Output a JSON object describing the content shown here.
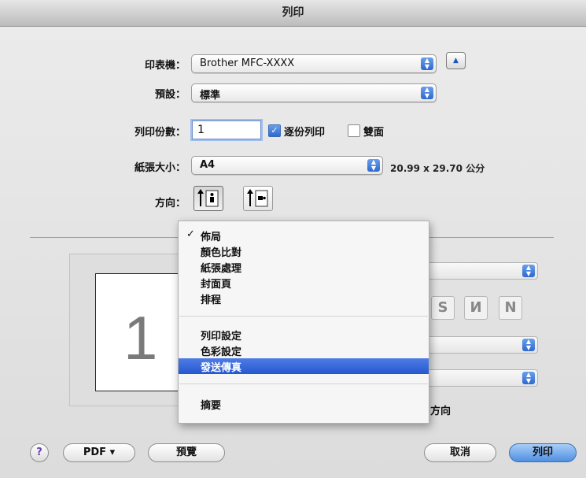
{
  "window": {
    "title": "列印"
  },
  "printer": {
    "label": "印表機：",
    "value": "Brother MFC-XXXX"
  },
  "presets": {
    "label": "預設：",
    "value": "標準"
  },
  "copies": {
    "label": "列印份數：",
    "value": "1",
    "collate_label": "逐份列印",
    "collate_checked": true,
    "duplex_label": "雙面",
    "duplex_checked": false
  },
  "paper_size": {
    "label": "紙張大小：",
    "value": "A4",
    "dimensions": "20.99 x 29.70 公分"
  },
  "orientation": {
    "label": "方向：",
    "selected": "portrait"
  },
  "preview": {
    "page_number": "1"
  },
  "panel_menu": {
    "items": [
      {
        "label": "佈局",
        "checked": true,
        "check": "✓"
      },
      {
        "label": "顏色比對"
      },
      {
        "label": "紙張處理"
      },
      {
        "label": "封面頁"
      },
      {
        "label": "排程"
      },
      {
        "label": "列印設定"
      },
      {
        "label": "色彩設定"
      },
      {
        "label": "發送傳真",
        "highlighted": true
      },
      {
        "label": "摘要"
      }
    ]
  },
  "behind_menu": {
    "direction_label": "方向"
  },
  "buttons": {
    "help": "?",
    "pdf": "PDF ▾",
    "preview": "預覽",
    "cancel": "取消",
    "print": "列印"
  },
  "colors": {
    "accent": "#2558cf",
    "highlight": "#3d6ad6",
    "window_bg": "#e4e4e4"
  }
}
